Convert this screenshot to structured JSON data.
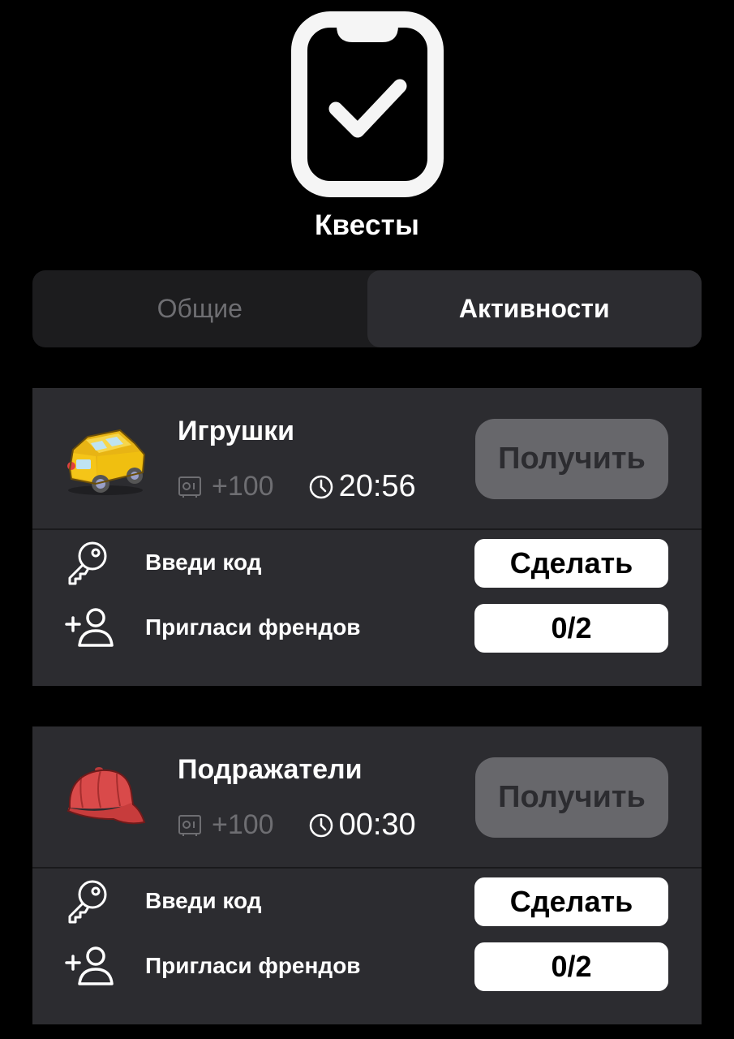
{
  "header": {
    "icon": "clipboard-check-icon",
    "title": "Квесты"
  },
  "tabs": [
    {
      "label": "Общие",
      "active": false
    },
    {
      "label": "Активности",
      "active": true
    }
  ],
  "quests": [
    {
      "title": "Игрушки",
      "image": "toy-car-icon",
      "reward": "+100",
      "timer": "20:56",
      "claim_label": "Получить",
      "tasks": [
        {
          "icon": "key-icon",
          "label": "Введи код",
          "button": "Сделать"
        },
        {
          "icon": "add-user-icon",
          "label": "Пригласи френдов",
          "button": "0/2"
        }
      ]
    },
    {
      "title": "Подражатели",
      "image": "red-cap-icon",
      "reward": "+100",
      "timer": "00:30",
      "claim_label": "Получить",
      "tasks": [
        {
          "icon": "key-icon",
          "label": "Введи код",
          "button": "Сделать"
        },
        {
          "icon": "add-user-icon",
          "label": "Пригласи френдов",
          "button": "0/2"
        }
      ]
    }
  ],
  "colors": {
    "background": "#000000",
    "card": "#2c2c30",
    "tab_bar": "#1c1c1e",
    "muted_text": "#6e6e72",
    "claim_button_disabled": "#67676b",
    "car_yellow": "#f5c518",
    "cap_red": "#d94a4a"
  }
}
